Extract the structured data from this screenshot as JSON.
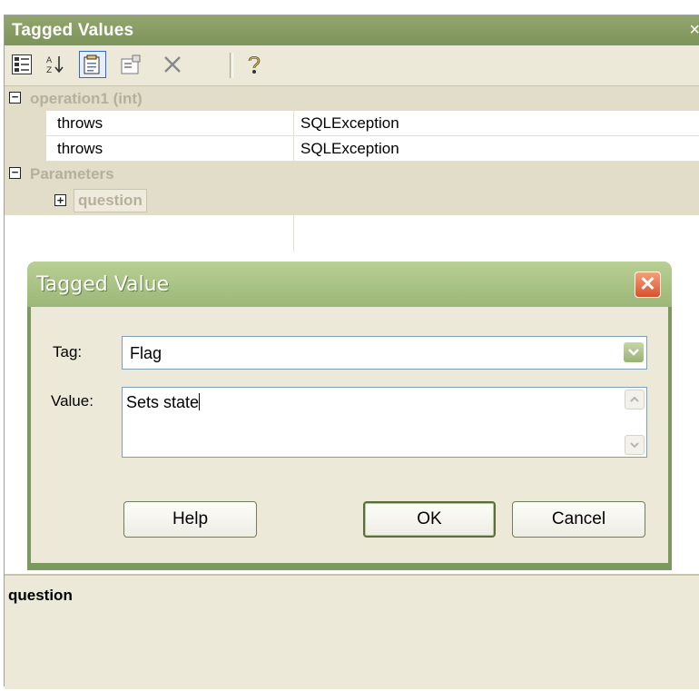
{
  "window": {
    "title": "Tagged Values",
    "close_glyph": "×"
  },
  "toolbar": {
    "buttons": [
      {
        "name": "categorized-view-icon"
      },
      {
        "name": "sort-az-icon"
      },
      {
        "name": "new-tag-icon"
      },
      {
        "name": "properties-icon"
      },
      {
        "name": "delete-icon"
      },
      {
        "name": "help-icon"
      }
    ]
  },
  "grid": {
    "group1": {
      "expander": "−",
      "label": "operation1 (int)"
    },
    "rows": [
      {
        "tag": "throws",
        "value": "SQLException"
      },
      {
        "tag": "throws",
        "value": "SQLException"
      }
    ],
    "group2": {
      "expander": "−",
      "label": "Parameters"
    },
    "param": {
      "expander": "+",
      "label": "question"
    }
  },
  "description": {
    "name": "question"
  },
  "dialog": {
    "title": "Tagged Value",
    "close_glyph": "✕",
    "tag_label": "Tag:",
    "tag_value": "Flag",
    "value_label": "Value:",
    "value_text": "Sets state",
    "help_label": "Help",
    "ok_label": "OK",
    "cancel_label": "Cancel"
  },
  "colors": {
    "titlebar": "#7e9459",
    "dialog_frame": "#7c9a5f",
    "face": "#ece9d8",
    "group_band": "#e1ddc8"
  }
}
